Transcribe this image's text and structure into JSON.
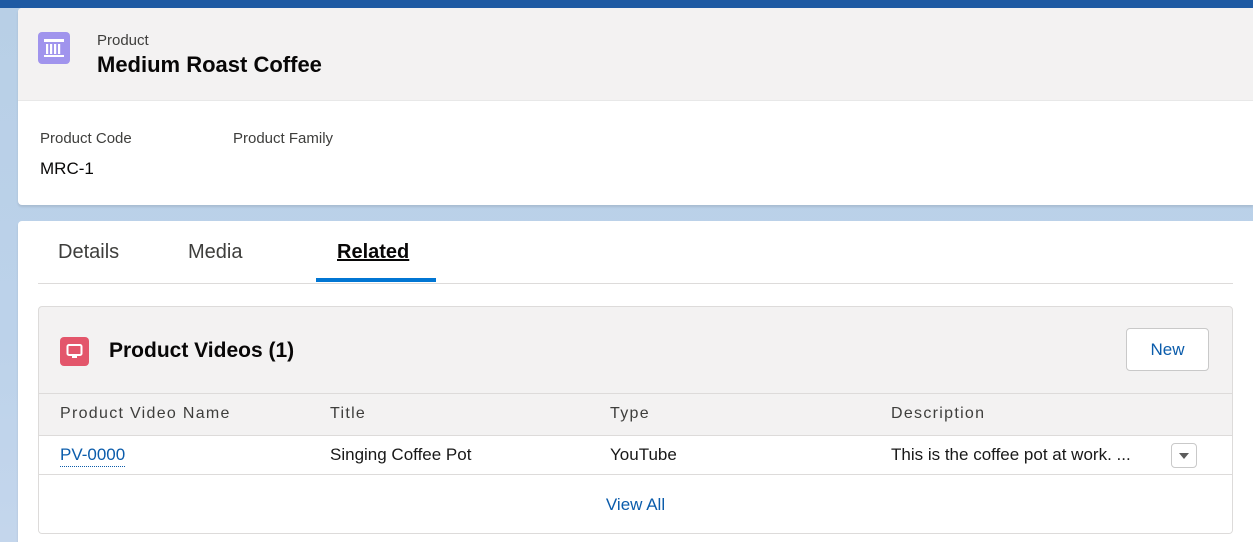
{
  "header": {
    "object_label": "Product",
    "record_title": "Medium Roast Coffee",
    "icon": "product-icon",
    "fields": [
      {
        "label": "Product Code",
        "value": "MRC-1"
      },
      {
        "label": "Product Family",
        "value": ""
      }
    ]
  },
  "tabs": [
    {
      "label": "Details",
      "active": false
    },
    {
      "label": "Media",
      "active": false
    },
    {
      "label": "Related",
      "active": true
    }
  ],
  "related_list": {
    "icon": "product-video-icon",
    "title": "Product Videos (1)",
    "new_button": "New",
    "columns": [
      "Product Video Name",
      "Title",
      "Type",
      "Description"
    ],
    "rows": [
      {
        "name": "PV-0000",
        "title": "Singing Coffee Pot",
        "type": "YouTube",
        "description": "This is the coffee pot at work. ...",
        "menu_icon": "chevron-down-icon"
      }
    ],
    "view_all": "View All"
  },
  "colors": {
    "accent": "#0176d3",
    "link": "#0b5cab",
    "product_icon_bg": "#a094ed",
    "video_icon_bg": "#e3566b"
  }
}
